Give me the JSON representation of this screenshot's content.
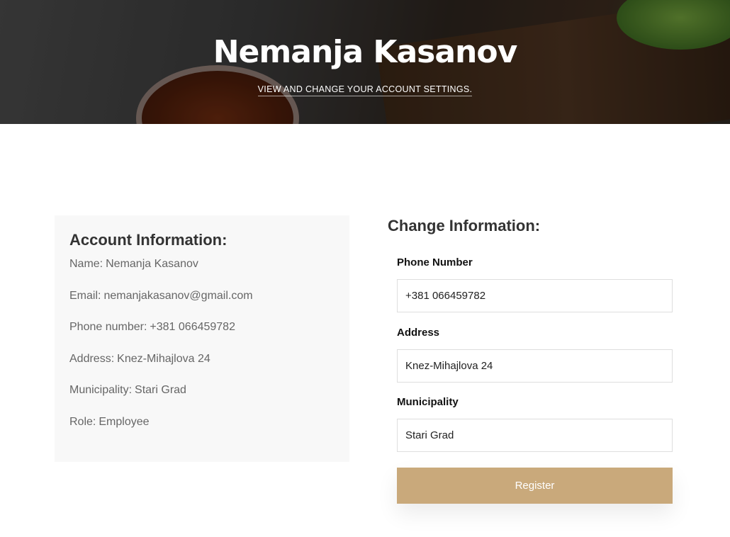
{
  "header": {
    "title": "Nemanja Kasanov",
    "subtitle": "VIEW AND CHANGE YOUR ACCOUNT SETTINGS."
  },
  "account_info": {
    "title": "Account Information:",
    "items": [
      {
        "label": "Name:",
        "value": "Nemanja Kasanov"
      },
      {
        "label": "Email:",
        "value": "nemanjakasanov@gmail.com"
      },
      {
        "label": "Phone number:",
        "value": "+381 066459782"
      },
      {
        "label": "Address:",
        "value": "Knez-Mihajlova 24"
      },
      {
        "label": "Municipality:",
        "value": "Stari Grad"
      },
      {
        "label": "Role:",
        "value": "Employee"
      }
    ]
  },
  "change_form": {
    "title": "Change Information:",
    "phone": {
      "label": "Phone Number",
      "value": "+381 066459782"
    },
    "address": {
      "label": "Address",
      "value": "Knez-Mihajlova 24"
    },
    "municipality": {
      "label": "Municipality",
      "value": "Stari Grad"
    },
    "submit_label": "Register"
  },
  "colors": {
    "accent": "#c9a97b",
    "panel_background": "#f8f8f8"
  }
}
